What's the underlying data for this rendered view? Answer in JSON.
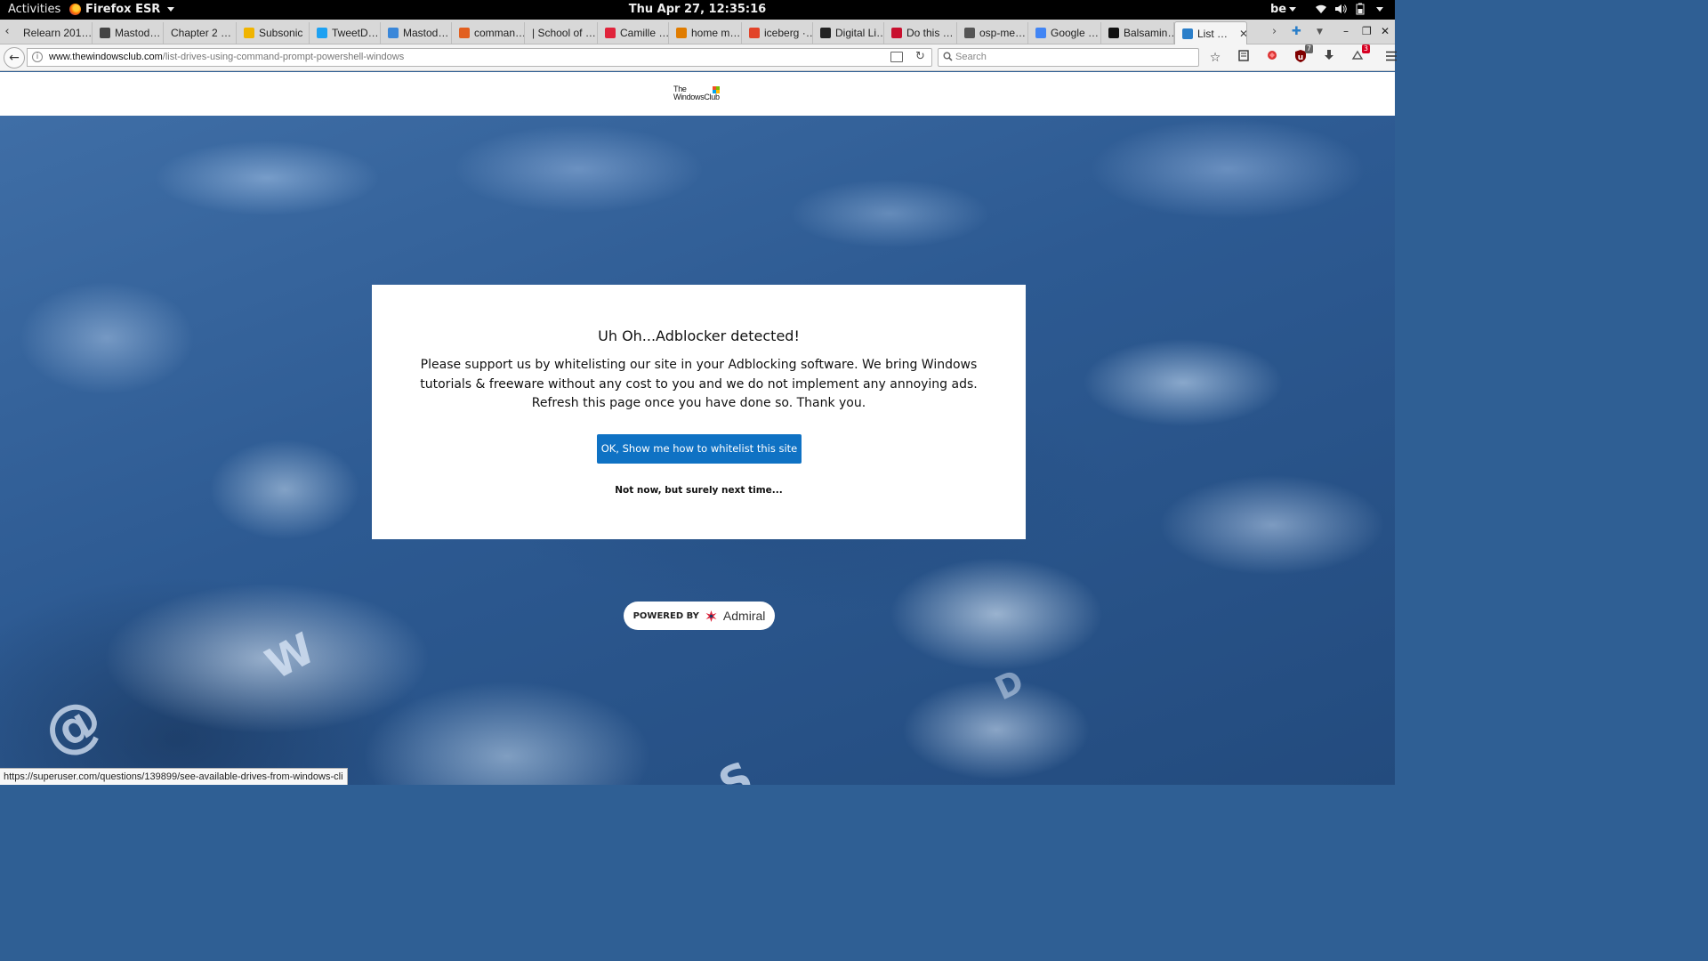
{
  "topbar": {
    "activities": "Activities",
    "app_name": "Firefox ESR",
    "clock": "Thu Apr 27, 12:35:16",
    "keyboard_layout": "be"
  },
  "tabs": [
    {
      "label": "Relearn 201…",
      "icon": "none",
      "color": ""
    },
    {
      "label": "Mastod…",
      "icon": "mastodon-icon",
      "color": "#444444"
    },
    {
      "label": "Chapter 2 …",
      "icon": "none",
      "color": ""
    },
    {
      "label": "Subsonic",
      "icon": "subsonic-icon",
      "color": "#f0b400"
    },
    {
      "label": "TweetD…",
      "icon": "tweetdeck-icon",
      "color": "#1da1f2"
    },
    {
      "label": "Mastod…",
      "icon": "mastodon-icon",
      "color": "#3a87d9"
    },
    {
      "label": "comman…",
      "icon": "askubuntu-icon",
      "color": "#e25f1f"
    },
    {
      "label": "| School of …",
      "icon": "none",
      "color": ""
    },
    {
      "label": "Camille …",
      "icon": "camille-icon",
      "color": "#e0243b"
    },
    {
      "label": "home m…",
      "icon": "home-icon",
      "color": "#e07c00"
    },
    {
      "label": "iceberg ·…",
      "icon": "gitlab-icon",
      "color": "#e24329"
    },
    {
      "label": "Digital Li…",
      "icon": "wikipedia-icon",
      "color": "#222222"
    },
    {
      "label": "Do this …",
      "icon": "do-this-icon",
      "color": "#c8102e"
    },
    {
      "label": "osp-me…",
      "icon": "osp-icon",
      "color": "#555555"
    },
    {
      "label": "Google …",
      "icon": "google-icon",
      "color": "#4285f4"
    },
    {
      "label": "Balsamin…",
      "icon": "balsamiq-icon",
      "color": "#111111"
    },
    {
      "label": "List …",
      "icon": "windowsclub-icon",
      "color": "#2a7ec9",
      "active": true
    }
  ],
  "navbar": {
    "url_domain": "www.thewindowsclub.com",
    "url_path": "/list-drives-using-command-prompt-powershell-windows",
    "search_placeholder": "Search",
    "ublock_badge": "7",
    "extension_badge": "3"
  },
  "site": {
    "logo_line1": "The",
    "logo_line2": "WindowsClub"
  },
  "modal": {
    "title": "Uh Oh...Adblocker detected!",
    "body": "Please support us by whitelisting our site in your Adblocking software. We bring Windows tutorials & freeware without any cost to you and we do not implement any annoying ads. Refresh this page once you have done so. Thank you.",
    "primary_button": "OK, Show me how to whitelist this site",
    "secondary_link": "Not now, but surely next time..."
  },
  "powered": {
    "prefix": "POWERED BY",
    "brand": "Admiral"
  },
  "statusbar": {
    "url": "https://superuser.com/questions/139899/see-available-drives-from-windows-cli"
  },
  "colors": {
    "primary_button": "#0f72c4",
    "hero_blue": "#2d5a92"
  }
}
